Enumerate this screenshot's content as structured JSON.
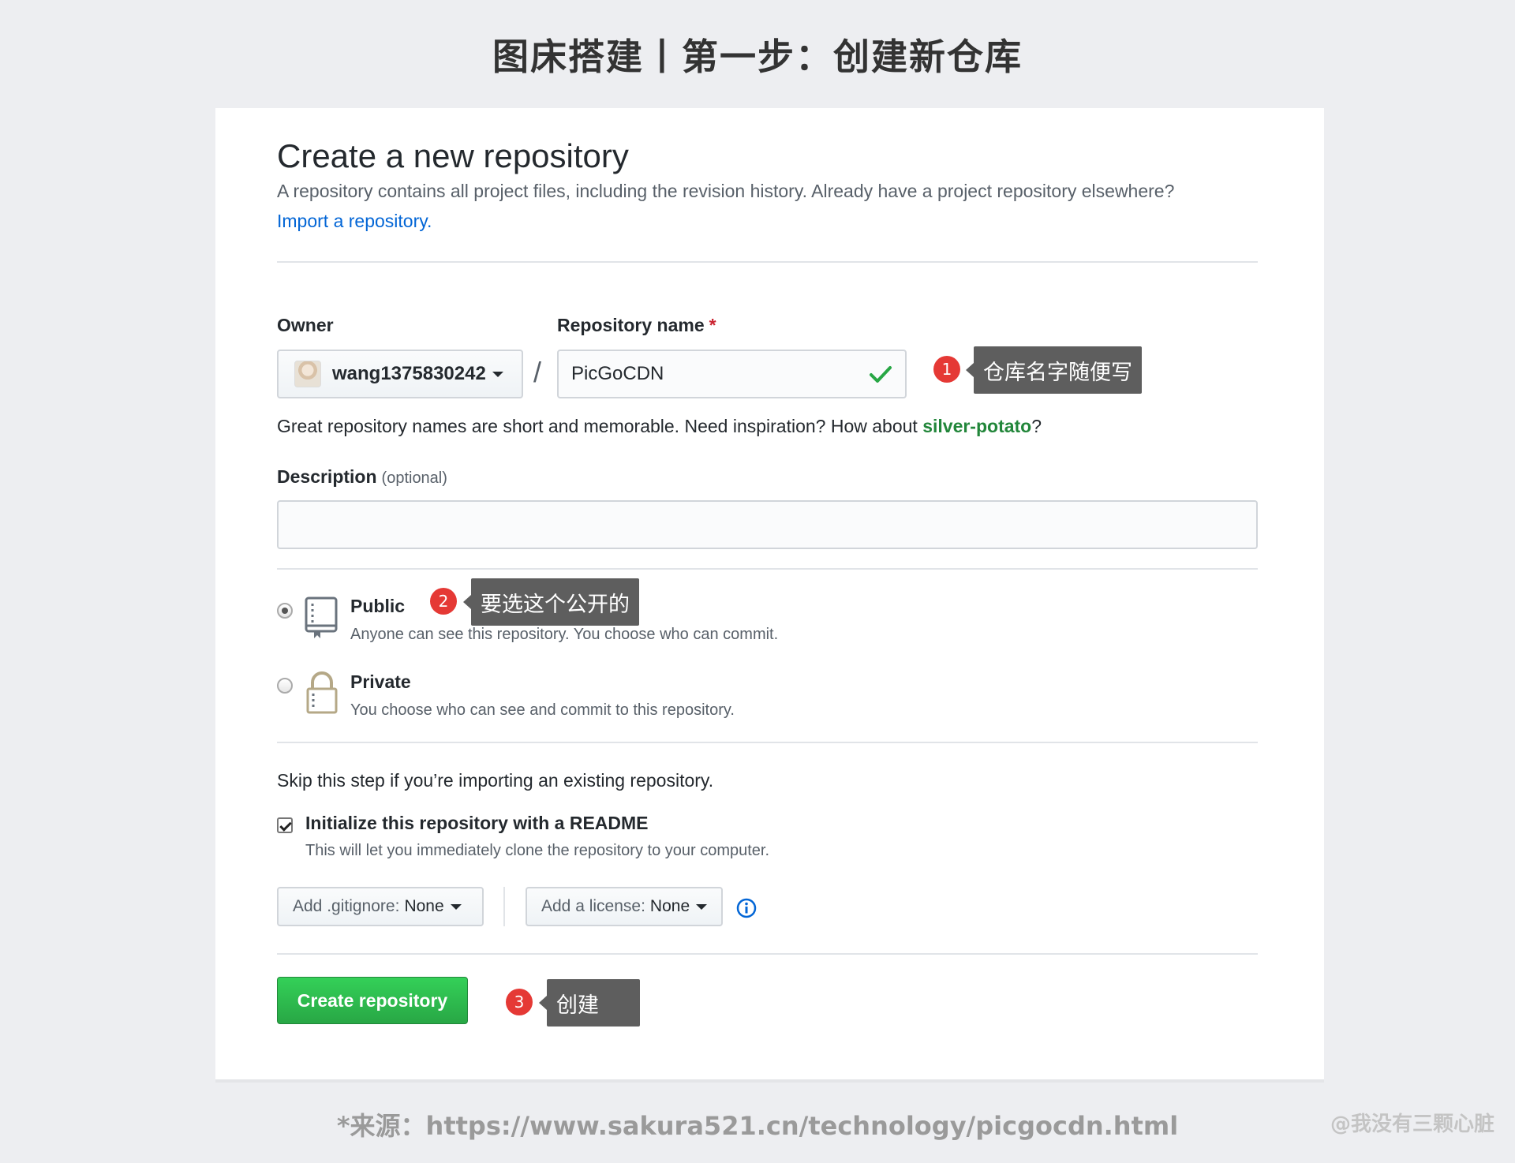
{
  "heading": "图床搭建丨第一步：创建新仓库",
  "form": {
    "title": "Create a new repository",
    "subtitle": "A repository contains all project files, including the revision history. Already have a project repository elsewhere?",
    "import_link": "Import a repository.",
    "owner_label": "Owner",
    "owner_value": "wang1375830242",
    "repo_label": "Repository name",
    "required_mark": "*",
    "separator": "/",
    "repo_value": "PicGoCDN",
    "hint_prefix": "Great repository names are short and memorable. Need inspiration? How about ",
    "hint_suggestion": "silver-potato",
    "hint_suffix": "?",
    "description_label": "Description",
    "description_optional": "(optional)",
    "description_value": "",
    "visibility": {
      "selected": "Public",
      "public_title": "Public",
      "public_note": "Anyone can see this repository. You choose who can commit.",
      "private_title": "Private",
      "private_note": "You choose who can see and commit to this repository."
    },
    "skip_text": "Skip this step if you’re importing an existing repository.",
    "init_readme_checked": true,
    "init_title": "Initialize this repository with a README",
    "init_note": "This will let you immediately clone the repository to your computer.",
    "gitignore_label": "Add .gitignore:",
    "gitignore_value": "None",
    "license_label": "Add a license:",
    "license_value": "None",
    "create_button": "Create repository"
  },
  "annotations": [
    {
      "number": "1",
      "text": "仓库名字随便写"
    },
    {
      "number": "2",
      "text": "要选这个公开的"
    },
    {
      "number": "3",
      "text": "创建"
    }
  ],
  "footer": {
    "source": "*来源：https://www.sakura521.cn/technology/picgocdn.html",
    "watermark": "@我没有三颗心脏"
  },
  "colors": {
    "background": "#edeef1",
    "link": "#0366d6",
    "create_button": "#2ea44f",
    "badge": "#e53935",
    "callout": "#5e5e5e"
  }
}
